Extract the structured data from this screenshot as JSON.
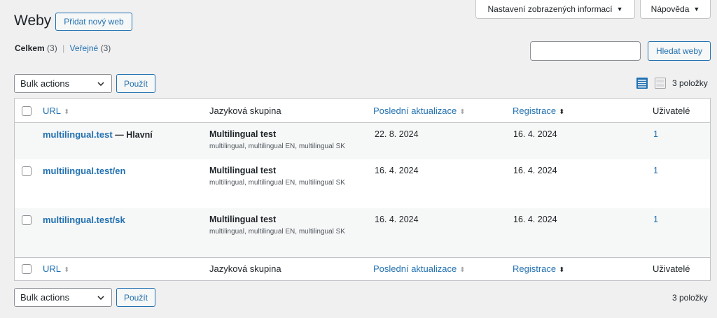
{
  "page": {
    "title": "Weby",
    "add_new": "Přidat nový web"
  },
  "screen_tabs": {
    "options": "Nastavení zobrazených informací",
    "help": "Nápověda",
    "arrow": "▼"
  },
  "filters": {
    "all_label": "Celkem",
    "all_count": "(3)",
    "sep": "|",
    "public_label": "Veřejné",
    "public_count": "(3)"
  },
  "search": {
    "value": "",
    "button": "Hledat weby"
  },
  "bulk": {
    "selected": "Bulk actions",
    "apply": "Použít"
  },
  "view": {
    "count": "3 položky"
  },
  "columns": {
    "url": "URL",
    "lang": "Jazyková skupina",
    "updated": "Poslední aktualizace",
    "registered": "Registrace",
    "users": "Uživatelé"
  },
  "rows": [
    {
      "url": "multilingual.test",
      "suffix": "— Hlavní",
      "group": "Multilingual test",
      "langs": "multilingual, multilingual EN, multilingual SK",
      "updated": "22. 8. 2024",
      "registered": "16. 4. 2024",
      "users": "1"
    },
    {
      "url": "multilingual.test/en",
      "suffix": "",
      "group": "Multilingual test",
      "langs": "multilingual, multilingual EN, multilingual SK",
      "updated": "16. 4. 2024",
      "registered": "16. 4. 2024",
      "users": "1"
    },
    {
      "url": "multilingual.test/sk",
      "suffix": "",
      "group": "Multilingual test",
      "langs": "multilingual, multilingual EN, multilingual SK",
      "updated": "16. 4. 2024",
      "registered": "16. 4. 2024",
      "users": "1"
    }
  ],
  "colors": {
    "link": "#2271b1",
    "row_alt": "#f6f7f7",
    "border": "#c3c4c7"
  }
}
